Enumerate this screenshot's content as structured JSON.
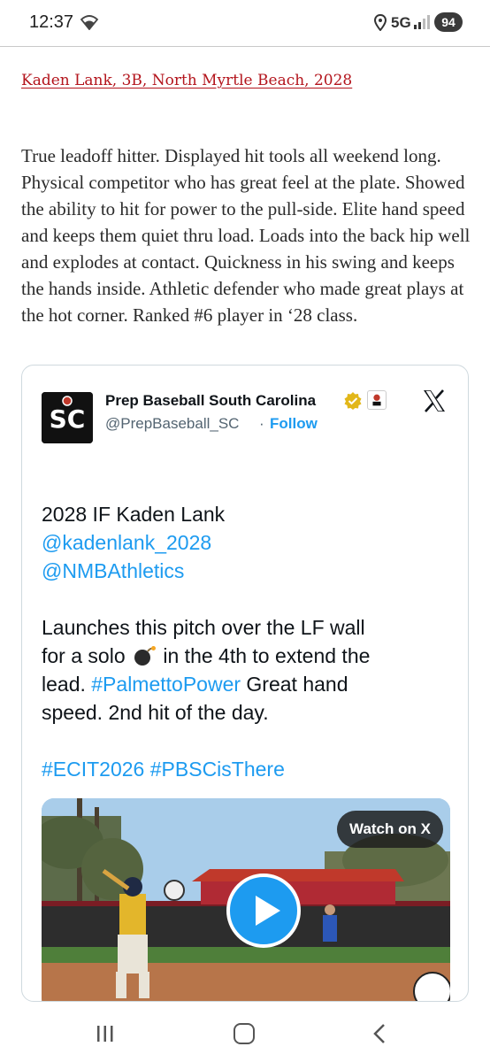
{
  "status_bar": {
    "time": "12:37",
    "network": "5G",
    "battery": "94",
    "icons": [
      "wifi-icon",
      "location-icon",
      "signal-icon",
      "battery-icon"
    ]
  },
  "article": {
    "player_link": "Kaden Lank, 3B, North Myrtle Beach, 2028",
    "body": "True leadoff hitter. Displayed hit tools all weekend long. Physical competitor who has great feel at the plate. Showed the ability to hit for power to the pull-side. Elite hand speed and keeps them quiet thru load. Loads into the back hip well and explodes at contact. Quickness in his swing and keeps the hands inside. Athletic defender who made great plays at the hot corner. Ranked #6 player in ‘28 class."
  },
  "tweet": {
    "user_name": "Prep Baseball South Carolina",
    "handle": "@PrepBaseball_SC",
    "separator": "·",
    "follow_label": "Follow",
    "line1": "2028 IF Kaden Lank",
    "mention1": "@kadenlank_2028",
    "mention2": "@NMBAthletics",
    "line4": "Launches this pitch over the LF wall",
    "line5a": "for a solo",
    "line5b": "in the 4th to extend the",
    "line6a": "lead.",
    "hashtag1": "#PalmettoPower",
    "line6b": "Great hand",
    "line7": "speed. 2nd hit of the day.",
    "hashtag2": "#ECIT2026",
    "hashtag3": "#PBSCisThere",
    "watch_label": "Watch on X",
    "colors": {
      "link_blue": "#1d9bf0",
      "text": "#0f1419",
      "muted": "#536471",
      "article_link_red": "#b3141c"
    }
  },
  "nav_bar": {
    "icons": [
      "recents-icon",
      "home-icon",
      "back-icon"
    ]
  }
}
